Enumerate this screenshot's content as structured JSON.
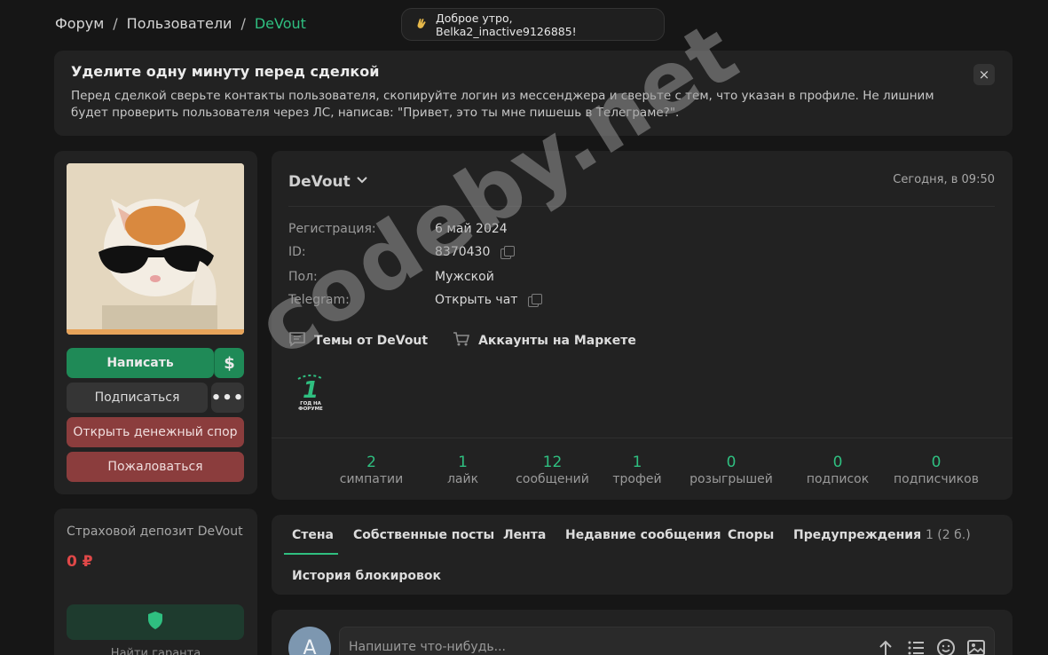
{
  "breadcrumb": {
    "items": [
      "Форум",
      "Пользователи"
    ],
    "separator": "/",
    "current": "DeVout"
  },
  "greeting": {
    "text": "Доброе утро, Belka2_inactive9126885!",
    "icon": "waving-hand-icon"
  },
  "notice": {
    "title": "Уделите одну минуту перед сделкой",
    "text": "Перед сделкой сверьте контакты пользователя, скопируйте логин из мессенджера и сверьте с тем, что указан в профиле. Не лишним будет проверить пользователя через ЛС, написав: \"Привет, это ты мне пишешь в Телеграме?\".",
    "close": "×"
  },
  "actions": {
    "write": "Написать",
    "dollar": "$",
    "subscribe": "Подписаться",
    "more": "•••",
    "dispute": "Открыть денежный спор",
    "report": "Пожаловаться"
  },
  "deposit": {
    "title": "Страховой депозит DeVout",
    "value": "0 ₽",
    "caption": "Найти гаранта"
  },
  "profile": {
    "name": "DeVout",
    "last_seen": "Сегодня, в 09:50",
    "info": [
      {
        "label": "Регистрация:",
        "value": "6 май 2024"
      },
      {
        "label": "ID:",
        "value": "8370430"
      },
      {
        "label": "Пол:",
        "value": "Мужской"
      },
      {
        "label": "Telegram:",
        "value": "Открыть чат"
      }
    ],
    "links": {
      "topics": "Темы от DeVout",
      "market": "Аккаунты на Маркете"
    },
    "badge": {
      "number": "1",
      "caption_line1": "ГОД НА",
      "caption_line2": "ФОРУМЕ"
    },
    "stats": [
      {
        "num": "2",
        "label": "симпатии"
      },
      {
        "num": "1",
        "label": "лайк"
      },
      {
        "num": "12",
        "label": "сообщений"
      },
      {
        "num": "1",
        "label": "трофей"
      },
      {
        "num": "0",
        "label": "розыгрышей"
      },
      {
        "num": "0",
        "label": "подписок"
      },
      {
        "num": "0",
        "label": "подписчиков"
      }
    ]
  },
  "tabs": {
    "wall": "Стена",
    "own_posts": "Собственные посты",
    "feed": "Лента",
    "recent": "Недавние сообщения",
    "disputes": "Споры",
    "warnings": "Предупреждения",
    "warnings_count": "1 (2 б.)",
    "bans": "История блокировок"
  },
  "comment": {
    "avatar_letter": "A",
    "placeholder": "Напишите что-нибудь..."
  },
  "watermark": "codeby.net",
  "colors": {
    "accent": "#2fbf80",
    "danger": "#8b3d3d",
    "primary_button": "#1f8a57"
  }
}
